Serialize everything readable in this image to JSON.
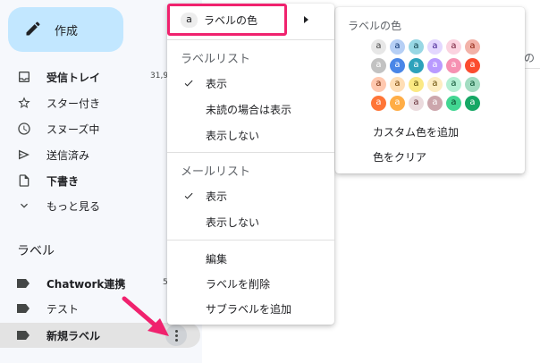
{
  "sidebar": {
    "compose_label": "作成",
    "nav": [
      {
        "label": "受信トレイ",
        "count": "31,9",
        "icon": "inbox-icon",
        "bold": true
      },
      {
        "label": "スター付き",
        "count": "",
        "icon": "star-icon",
        "bold": false
      },
      {
        "label": "スヌーズ中",
        "count": "",
        "icon": "clock-icon",
        "bold": false
      },
      {
        "label": "送信済み",
        "count": "",
        "icon": "send-icon",
        "bold": false
      },
      {
        "label": "下書き",
        "count": "",
        "icon": "file-icon",
        "bold": true
      },
      {
        "label": "もっと見る",
        "count": "",
        "icon": "chevron-down-icon",
        "bold": false
      }
    ],
    "labels_title": "ラベル",
    "labels": [
      {
        "label": "Chatwork連携",
        "count": "5",
        "bold": true
      },
      {
        "label": "テスト",
        "count": "",
        "bold": false
      },
      {
        "label": "新規ラベル",
        "count": "",
        "bold": true
      }
    ]
  },
  "menu": {
    "label_color_chip": "a",
    "label_color": "ラベルの色",
    "label_list_header": "ラベルリスト",
    "label_list": [
      "表示",
      "未読の場合は表示",
      "表示しない"
    ],
    "mail_list_header": "メールリスト",
    "mail_list": [
      "表示",
      "表示しない"
    ],
    "actions": [
      "編集",
      "ラベルを削除",
      "サブラベルを追加"
    ]
  },
  "color_submenu": {
    "header": "ラベルの色",
    "swatch_letter": "a",
    "rows": [
      [
        {
          "bg": "#e7e7e7",
          "fg": "#464646"
        },
        {
          "bg": "#b6cff5",
          "fg": "#0d3472"
        },
        {
          "bg": "#98d7e4",
          "fg": "#0d3b44"
        },
        {
          "bg": "#e3d7ff",
          "fg": "#3d188e"
        },
        {
          "bg": "#fbd3e0",
          "fg": "#711a36"
        },
        {
          "bg": "#f2b2a8",
          "fg": "#8a1c0a"
        }
      ],
      [
        {
          "bg": "#c2c2c2",
          "fg": "#ffffff"
        },
        {
          "bg": "#4986e7",
          "fg": "#ffffff"
        },
        {
          "bg": "#2da2bb",
          "fg": "#ffffff"
        },
        {
          "bg": "#b99aff",
          "fg": "#ffffff"
        },
        {
          "bg": "#f691b2",
          "fg": "#ffffff"
        },
        {
          "bg": "#fb4c2f",
          "fg": "#ffffff"
        }
      ],
      [
        {
          "bg": "#ffc8af",
          "fg": "#7a2e0b"
        },
        {
          "bg": "#ffdeb5",
          "fg": "#7a4706"
        },
        {
          "bg": "#fbe983",
          "fg": "#594c05"
        },
        {
          "bg": "#fdedc1",
          "fg": "#684e07"
        },
        {
          "bg": "#b3efd3",
          "fg": "#0b4f30"
        },
        {
          "bg": "#a2dcc1",
          "fg": "#04502e"
        }
      ],
      [
        {
          "bg": "#ff7537",
          "fg": "#ffffff"
        },
        {
          "bg": "#ffad46",
          "fg": "#ffffff"
        },
        {
          "bg": "#ebdbde",
          "fg": "#662e37"
        },
        {
          "bg": "#cca6ac",
          "fg": "#ffffff"
        },
        {
          "bg": "#42d692",
          "fg": "#094228"
        },
        {
          "bg": "#16a765",
          "fg": "#ffffff"
        }
      ]
    ],
    "add_custom": "カスタム色を追加",
    "clear": "色をクリア"
  },
  "colors": {
    "highlight": "#f0226e",
    "arrow": "#f0226e",
    "compose_bg": "#c2e7ff"
  }
}
